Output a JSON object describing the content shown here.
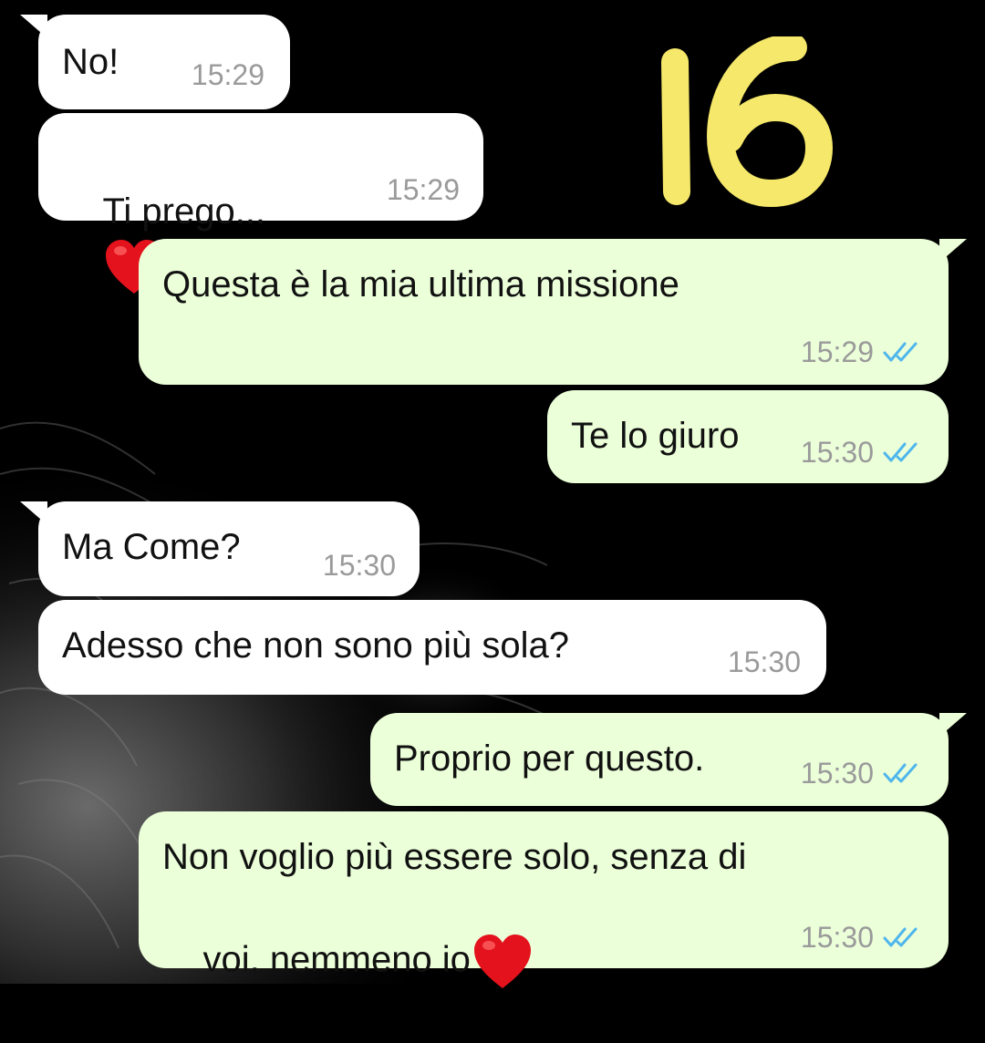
{
  "conversation": {
    "badge_number": "16",
    "messages": [
      {
        "dir": "in",
        "text": "No!",
        "time": "15:29"
      },
      {
        "dir": "in",
        "text": "Ti prego...",
        "emoji": "red-heart",
        "time": "15:29"
      },
      {
        "dir": "out",
        "text": "Questa è la mia ultima missione",
        "time": "15:29",
        "status": "read"
      },
      {
        "dir": "out",
        "text": "Te lo giuro",
        "time": "15:30",
        "status": "read"
      },
      {
        "dir": "in",
        "text": "Ma Come?",
        "time": "15:30"
      },
      {
        "dir": "in",
        "text": "Adesso che non sono più sola?",
        "time": "15:30"
      },
      {
        "dir": "out",
        "text": "Proprio per questo.",
        "time": "15:30",
        "status": "read"
      },
      {
        "dir": "out",
        "text_line1": "Non voglio più essere solo, senza di",
        "text_line2": "voi, nemmeno io",
        "emoji": "red-heart",
        "time": "15:30",
        "status": "read"
      }
    ]
  },
  "colors": {
    "incoming_bubble": "#ffffff",
    "outgoing_bubble": "#ebffd9",
    "read_ticks": "#4fb6ec",
    "timestamp": "#9a9a9a",
    "badge": "#f5e86a",
    "background": "#000000"
  }
}
